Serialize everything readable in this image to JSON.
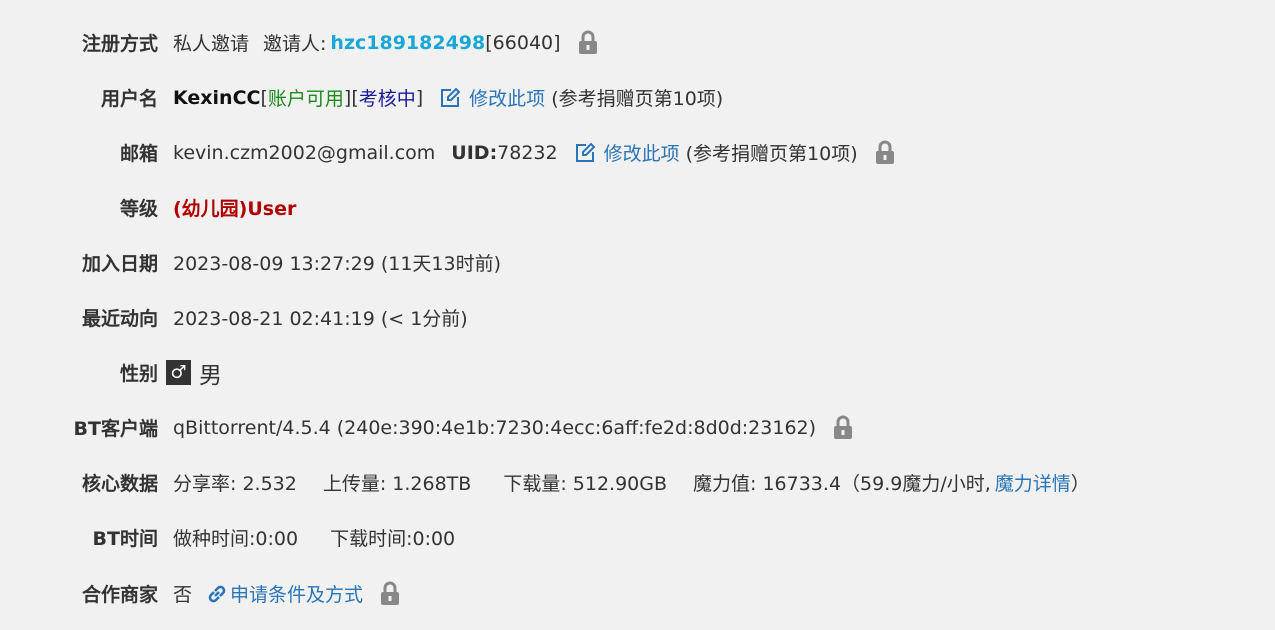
{
  "rows": {
    "invite": {
      "label": "注册方式",
      "method": "私人邀请",
      "inviter_prefix": "邀请人:",
      "inviter_name": "hzc189182498",
      "inviter_id": "[66040]"
    },
    "username": {
      "label": "用户名",
      "name": "KexinCC",
      "bracket_open_1": "[",
      "status_1": "账户可用",
      "bracket_mid": "][",
      "status_2": "考核中",
      "bracket_close": "]",
      "edit_link": "修改此项",
      "edit_note": "(参考捐赠页第10项)"
    },
    "email": {
      "label": "邮箱",
      "address": "kevin.czm2002@gmail.com",
      "uid_label": "UID:",
      "uid_value": "78232",
      "edit_link": "修改此项",
      "edit_note": "(参考捐赠页第10项)"
    },
    "level": {
      "label": "等级",
      "value": "(幼儿园)User"
    },
    "joined": {
      "label": "加入日期",
      "value": "2023-08-09 13:27:29 (11天13时前)"
    },
    "last_action": {
      "label": "最近动向",
      "value": "2023-08-21 02:41:19 (< 1分前)"
    },
    "gender": {
      "label": "性别",
      "symbol": "♂",
      "value": "男"
    },
    "bt_client": {
      "label": "BT客户端",
      "value": "qBittorrent/4.5.4 (240e:390:4e1b:7230:4ecc:6aff:fe2d:8d0d:23162)"
    },
    "core_data": {
      "label": "核心数据",
      "share_ratio": "分享率: 2.532",
      "uploaded": "上传量: 1.268TB",
      "downloaded": "下载量: 512.90GB",
      "magic": "魔力值: 16733.4（59.9魔力/小时,",
      "magic_link": "魔力详情",
      "magic_close": "）"
    },
    "bt_time": {
      "label": "BT时间",
      "seed_time": "做种时间:0:00",
      "download_time": "下载时间:0:00"
    },
    "partner": {
      "label": "合作商家",
      "value": "否",
      "link": "申请条件及方式"
    }
  },
  "icons": {
    "lock": "lock-icon",
    "edit": "edit-icon",
    "chain": "link-icon"
  },
  "colors": {
    "background": "#f1f1f1",
    "inviter": "#1aa7d8",
    "link": "#2a74b8",
    "level": "#b00000",
    "account_ok": "#1e8a1e",
    "assessment": "#1a1a9a"
  }
}
